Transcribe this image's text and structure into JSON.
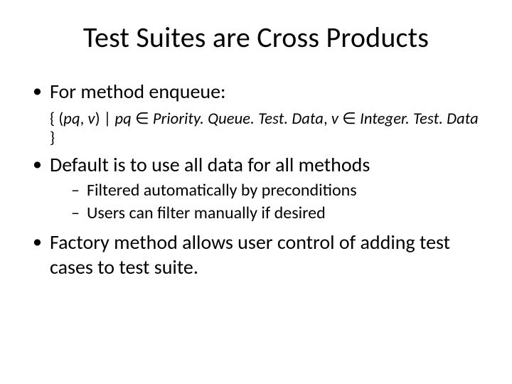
{
  "title": "Test Suites are Cross Products",
  "bullets": {
    "b1_prefix": "For method ",
    "b1_method": "enqueue",
    "b1_suffix": ":",
    "set_open": "{ (",
    "set_var1": "pq",
    "set_comma1": ", ",
    "set_var2": "v",
    "set_close_pair": ") ",
    "set_bar": "| ",
    "set_pq": "pq ",
    "set_in1": "∈ ",
    "set_class1": "Priority. Queue. Test. Data",
    "set_comma2": ", ",
    "set_v": "v ",
    "set_in2": "∈ ",
    "set_class2": "Integer. Test. Data",
    "set_end": " }",
    "b2": "Default is to use all data for all methods",
    "b2_sub1": "Filtered automatically by preconditions",
    "b2_sub2": "Users can filter manually if desired",
    "b3": "Factory method allows user control of adding test cases to test suite."
  }
}
